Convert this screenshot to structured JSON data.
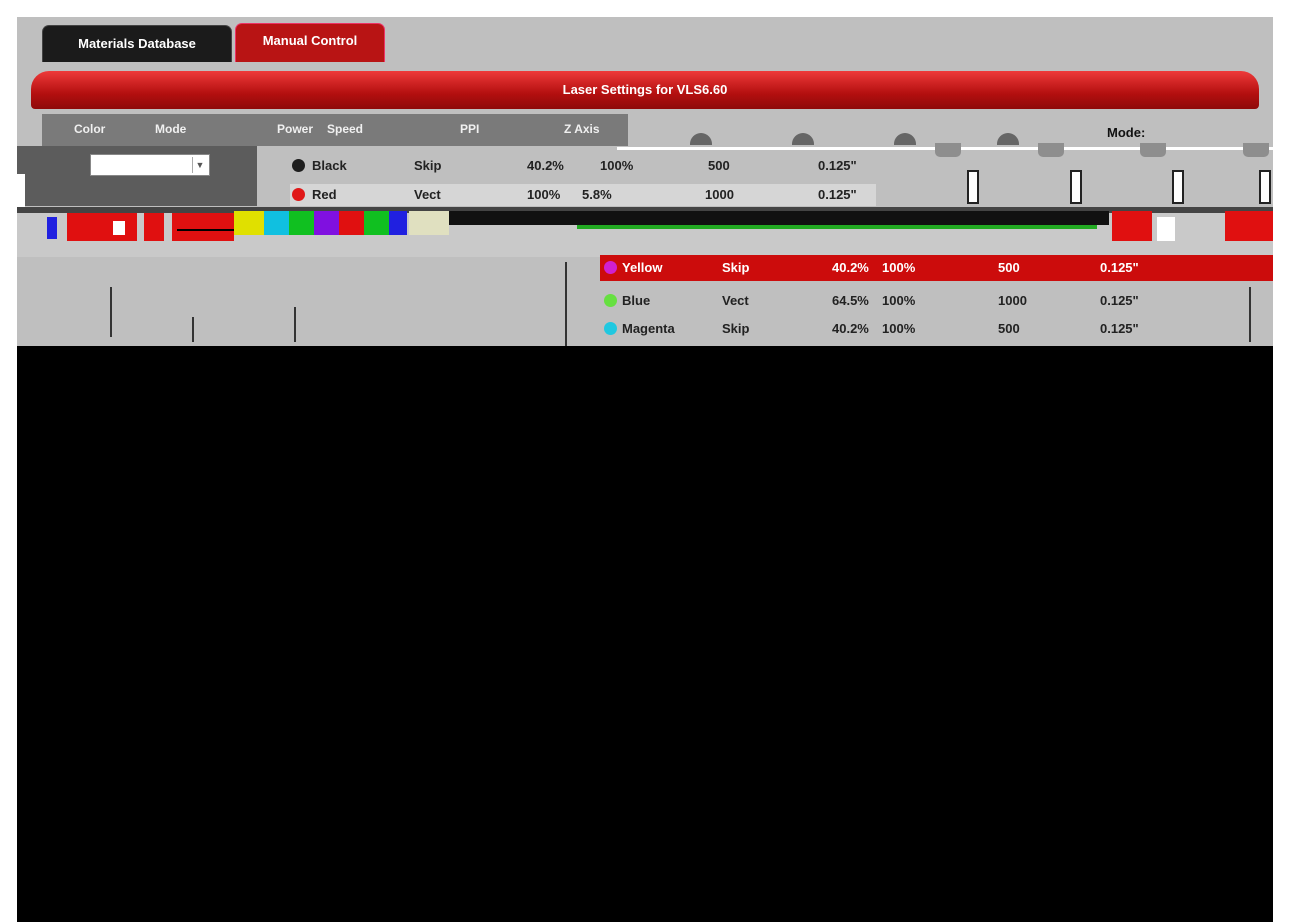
{
  "tabs": {
    "materials": "Materials Database",
    "manual": "Manual Control"
  },
  "header": {
    "title": "Laser Settings for VLS6.60"
  },
  "columns": {
    "color": "Color",
    "mode": "Mode",
    "power": "Power",
    "speed": "Speed",
    "ppi": "PPI",
    "zaxis": "Z Axis"
  },
  "mode_label": "Mode:",
  "rows": [
    {
      "color": "Black",
      "dot": "#1e1e1e",
      "mode": "Skip",
      "power": "40.2%",
      "speed": "100%",
      "ppi": "500",
      "z": "0.125\""
    },
    {
      "color": "Red",
      "dot": "#e01818",
      "mode": "Vect",
      "power": "100%",
      "speed": "5.8%",
      "ppi": "1000",
      "z": "0.125\""
    }
  ],
  "lower_rows": [
    {
      "color": "Yellow",
      "dot": "#d020d0",
      "mode": "Skip",
      "power": "40.2%",
      "speed": "100%",
      "ppi": "500",
      "z": "0.125\""
    },
    {
      "color": "Blue",
      "dot": "#66e040",
      "mode": "Vect",
      "power": "64.5%",
      "speed": "100%",
      "ppi": "1000",
      "z": "0.125\""
    },
    {
      "color": "Magenta",
      "dot": "#20c8e0",
      "mode": "Skip",
      "power": "40.2%",
      "speed": "100%",
      "ppi": "500",
      "z": "0.125\""
    }
  ],
  "colors": {
    "accent": "#b81414",
    "panel": "#bfbfbf",
    "background": "#000000"
  }
}
